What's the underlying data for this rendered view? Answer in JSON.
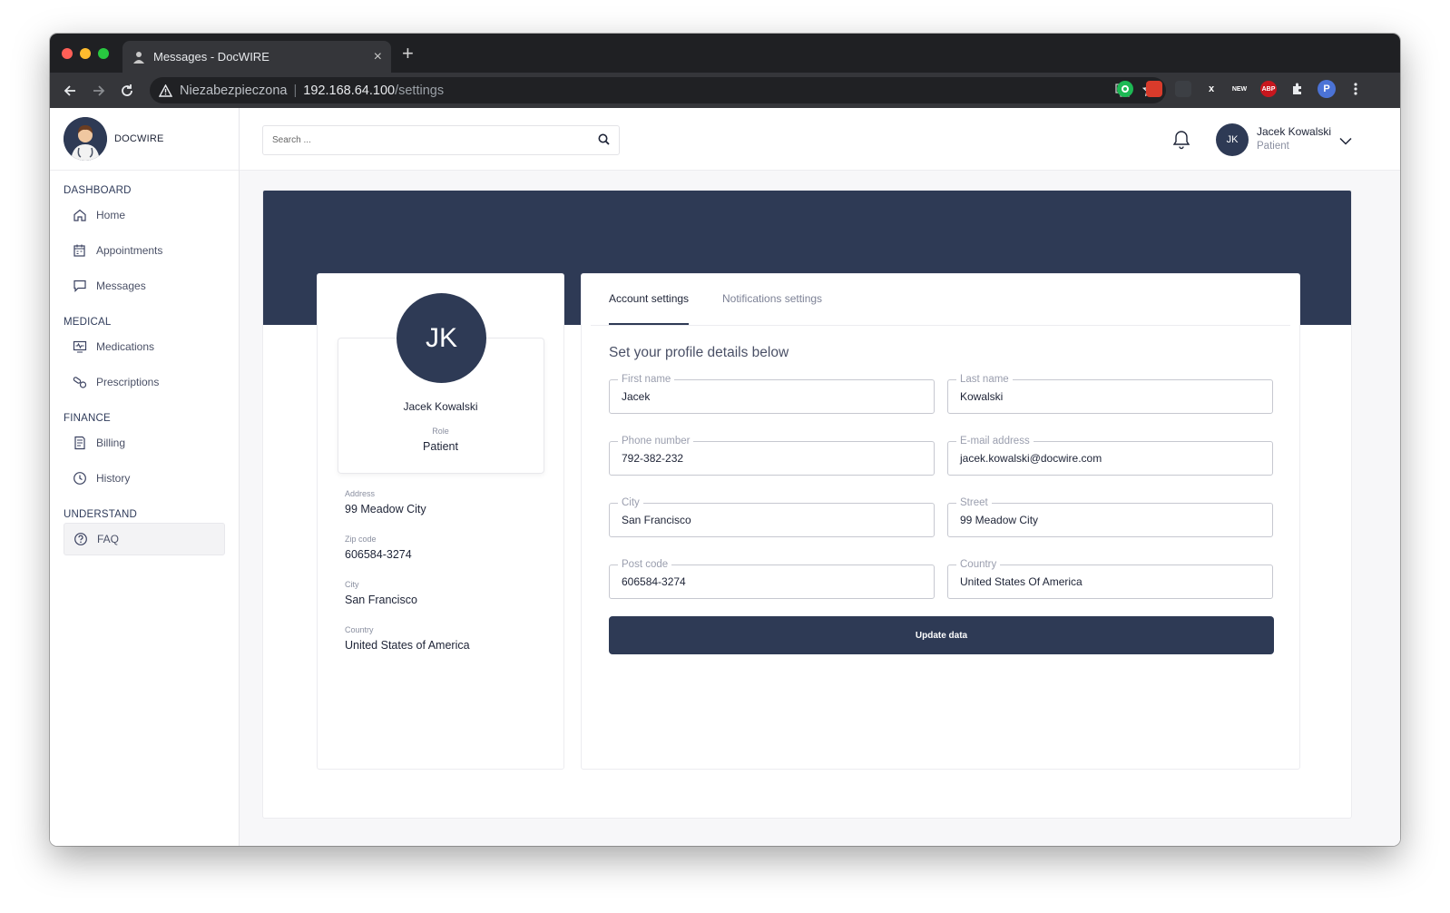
{
  "browser": {
    "tab_title": "Messages - DocWIRE",
    "tab_close": "×",
    "new_tab": "+",
    "address_insecure": "Niezabezpieczona",
    "address_host": "192.168.64.100",
    "address_path": "/settings",
    "extensions": [
      {
        "name": "target-extension-icon",
        "text": "",
        "color": "#1db954"
      },
      {
        "name": "red-extension-icon",
        "text": "",
        "color": "#d93b2b"
      },
      {
        "name": "grey-extension-icon",
        "text": "",
        "color": "#3c3f44"
      },
      {
        "name": "x-extension-icon",
        "text": "x",
        "color": "#35363a"
      },
      {
        "name": "new-extension-icon",
        "text": "NEW",
        "color": "#35363a"
      },
      {
        "name": "abp-extension-icon",
        "text": "ABP",
        "color": "#c8171e"
      }
    ],
    "profile_initial": "P"
  },
  "sidebar": {
    "brand": "DOCWIRE",
    "sections": [
      {
        "title": "DASHBOARD",
        "items": [
          {
            "label": "Home",
            "icon": "home-icon"
          },
          {
            "label": "Appointments",
            "icon": "calendar-icon"
          },
          {
            "label": "Messages",
            "icon": "message-icon"
          }
        ]
      },
      {
        "title": "MEDICAL",
        "items": [
          {
            "label": "Medications",
            "icon": "monitor-icon"
          },
          {
            "label": "Prescriptions",
            "icon": "pills-icon"
          }
        ]
      },
      {
        "title": "FINANCE",
        "items": [
          {
            "label": "Billing",
            "icon": "invoice-icon"
          },
          {
            "label": "History",
            "icon": "clock-icon"
          }
        ]
      },
      {
        "title": "UNDERSTAND",
        "items": [
          {
            "label": "FAQ",
            "icon": "question-icon"
          }
        ]
      }
    ]
  },
  "header": {
    "search_placeholder": "Search ...",
    "user_initials": "JK",
    "user_name": "Jacek Kowalski",
    "user_role": "Patient"
  },
  "profile": {
    "initials": "JK",
    "name": "Jacek Kowalski",
    "role_label": "Role",
    "role": "Patient",
    "info": [
      {
        "label": "Address",
        "value": "99 Meadow City"
      },
      {
        "label": "Zip code",
        "value": "606584-3274"
      },
      {
        "label": "City",
        "value": "San Francisco"
      },
      {
        "label": "Country",
        "value": "United States of America"
      }
    ]
  },
  "settings": {
    "tabs": [
      "Account settings",
      "Notifications settings"
    ],
    "subtitle": "Set your profile details below",
    "fields": [
      {
        "label": "First name",
        "value": "Jacek"
      },
      {
        "label": "Last name",
        "value": "Kowalski"
      },
      {
        "label": "Phone number",
        "value": "792-382-232"
      },
      {
        "label": "E-mail address",
        "value": "jacek.kowalski@docwire.com"
      },
      {
        "label": "City",
        "value": "San Francisco"
      },
      {
        "label": "Street",
        "value": "99 Meadow City"
      },
      {
        "label": "Post code",
        "value": "606584-3274"
      },
      {
        "label": "Country",
        "value": "United States Of America"
      }
    ],
    "submit_label": "Update data"
  },
  "colors": {
    "primary": "#2e3a55",
    "chrome_dark": "#1f2023",
    "chrome_toolbar": "#35363a"
  }
}
